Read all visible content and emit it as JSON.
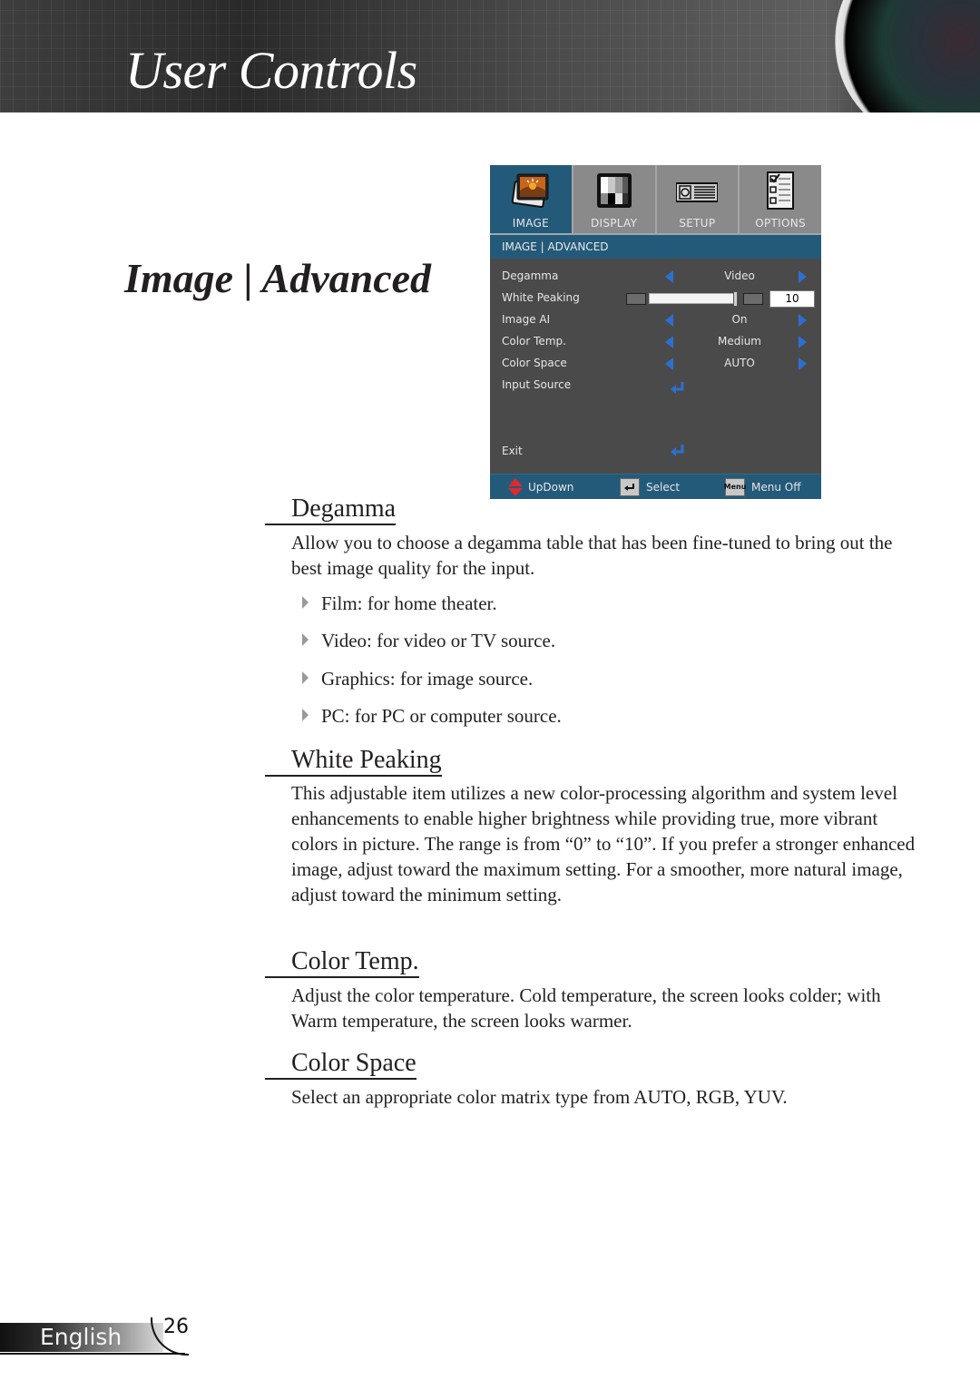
{
  "header": {
    "title": "User Controls"
  },
  "section_title": "Image | Advanced",
  "osd_menu": {
    "tabs": [
      {
        "label": "IMAGE",
        "icon": "image-icon",
        "active": true
      },
      {
        "label": "DISPLAY",
        "icon": "display-icon",
        "active": false
      },
      {
        "label": "SETUP",
        "icon": "projector-icon",
        "active": false
      },
      {
        "label": "OPTIONS",
        "icon": "checklist-icon",
        "active": false
      }
    ],
    "breadcrumb": "IMAGE | ADVANCED",
    "rows": [
      {
        "label": "Degamma",
        "value": "Video",
        "type": "selector"
      },
      {
        "label": "White Peaking",
        "value": "10",
        "type": "slider",
        "min": 0,
        "max": 10
      },
      {
        "label": "Image AI",
        "value": "On",
        "type": "selector"
      },
      {
        "label": "Color Temp.",
        "value": "Medium",
        "type": "selector"
      },
      {
        "label": "Color Space",
        "value": "AUTO",
        "type": "selector"
      },
      {
        "label": "Input Source",
        "type": "enter"
      },
      {
        "label": "Exit",
        "type": "enter"
      }
    ],
    "footer": [
      {
        "label": "UpDown",
        "icon": "up-down-arrows-icon"
      },
      {
        "label": "Select",
        "icon": "enter-key-icon"
      },
      {
        "label": "Menu Off",
        "icon": "menu-key-icon",
        "key_text": "Menu"
      }
    ],
    "colors": {
      "accent_blue": "#245a79",
      "arrow_blue": "#2d6fd0",
      "panel_gray": "#4a4a4a",
      "tab_gray": "#8a8a8a",
      "updown_red": "#e0282e"
    }
  },
  "sections": {
    "degamma": {
      "heading": "Degamma",
      "body": "Allow you to choose a degamma table that has been fine-tuned to bring out the best image quality for the input.",
      "bullets": [
        "Film: for home theater.",
        "Video: for video or TV source.",
        "Graphics: for image source.",
        "PC: for PC or computer source."
      ]
    },
    "white_peaking": {
      "heading": "White Peaking",
      "body": "This adjustable item utilizes a new color-processing algorithm and system level enhancements to enable higher brightness while providing true, more vibrant colors in picture. The range is from “0” to “10”. If you prefer a stronger enhanced image, adjust toward the maximum setting. For a smoother, more natural image, adjust toward the minimum setting."
    },
    "color_temp": {
      "heading": "Color Temp.",
      "body": "Adjust the color temperature. Cold temperature, the screen looks colder; with Warm temperature, the screen looks warmer."
    },
    "color_space": {
      "heading": "Color Space",
      "body": "Select an appropriate color matrix type from AUTO, RGB, YUV."
    }
  },
  "footer": {
    "language": "English",
    "page_number": "26"
  }
}
